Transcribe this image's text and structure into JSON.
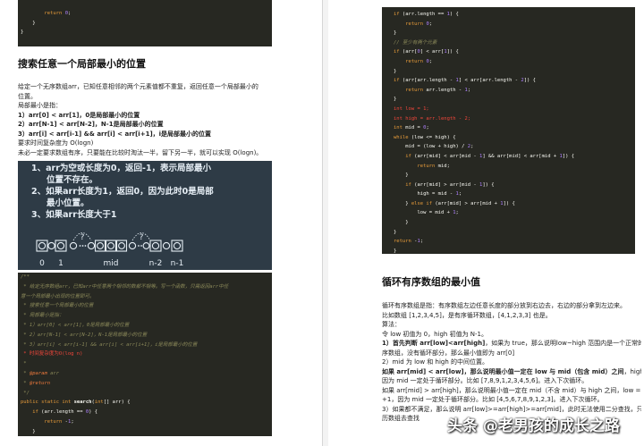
{
  "colors": {
    "page": "#ffffff",
    "text": "#222222",
    "divider": "#d6d6d6",
    "code_bg": "#272822",
    "code_text": "#f8f8f2",
    "keyword": "#e69b3a",
    "number": "#ae81ff",
    "comment": "#8c8a5a",
    "red": "#f2463b",
    "tag": "#f07a3c",
    "figure_bg": "#2e3b46",
    "figure_text": "#e6eef5",
    "watermark": "#ffffff"
  },
  "left_page": {
    "top_code": [
      [
        "        ",
        {
          "kw": "return"
        },
        " ",
        {
          "num": "0"
        },
        ";"
      ],
      "    }",
      "}"
    ],
    "heading": "搜索任意一个局部最小的位置",
    "paragraph_lines": [
      "给定一个无序数组arr，已知任意相邻的两个元素值都不重复，返回任意一个局部最小的",
      "位置。",
      "局部最小是指：",
      [
        {
          "b": "1）arr[0] < arr[1]，0是局部最小的位置"
        }
      ],
      [
        {
          "b": "2）arr[N-1] < arr[N-2]，N-1是局部最小的位置"
        }
      ],
      [
        {
          "b": "3）arr[i] < arr[i-1] && arr[i] < arr[i+1]，i是局部最小的位置"
        }
      ],
      "要求时间复杂度为 O(logn)",
      "未必一定要求数组有序，只要能在比较时淘汰一半，留下另一半，就可以实现 O(logn)。"
    ],
    "figure": {
      "lines": [
        "1、arr为空或长度为0，返回-1，表示局部最小",
        "位置不存在。",
        "2、如果arr长度为1，返回0，因为此时0是局部",
        "最小位置。",
        "3、如果arr长度大于1"
      ],
      "labels": [
        "0",
        "1",
        "mid",
        "n-2",
        "n-1"
      ],
      "question_marks": [
        "?",
        "?"
      ]
    },
    "code": [
      [
        {
          "com": "/**"
        }
      ],
      [
        {
          "com": " * 给定无序数组arr，已知arr中任意两个相邻的数都不相等。写一个函数，只需返回arr中任"
        }
      ],
      [
        {
          "com": "意一个局部最小出现的位置即可。"
        }
      ],
      [
        {
          "com": " * 搜索任意一个局部最小的位置"
        }
      ],
      [
        {
          "com": " * 局部最小是指："
        }
      ],
      [
        {
          "com": " * 1）arr[0] < arr[1]，0是局部最小的位置"
        }
      ],
      [
        {
          "com": " * 2）arr[N-1] < arr[N-2]，N-1是局部最小的位置"
        }
      ],
      [
        {
          "com": " * 3）arr[i] < arr[i-1] && arr[i] < arr[i+1]，i是局部最小的位置"
        }
      ],
      [
        {
          "red": " * 时间复杂度为O(log n)"
        }
      ],
      [
        {
          "com": " *"
        }
      ],
      [
        {
          "com": " * "
        },
        {
          "tag": "@param"
        },
        {
          "com": " arr"
        }
      ],
      [
        {
          "com": " * "
        },
        {
          "tag": "@return"
        }
      ],
      [
        {
          "com": " */"
        }
      ],
      [
        {
          "kw": "public static int"
        },
        " ",
        {
          "fn": "search"
        },
        "(",
        {
          "kw": "int"
        },
        "[] arr) {"
      ],
      [
        "    ",
        {
          "kw": "if"
        },
        " (arr.length == ",
        {
          "num": "0"
        },
        ") {"
      ],
      [
        "        ",
        {
          "kw": "return"
        },
        " -",
        {
          "num": "1"
        },
        ";"
      ],
      "    }"
    ]
  },
  "right_page": {
    "code": [
      [
        {
          "kw": "if"
        },
        " (arr.length == ",
        {
          "num": "1"
        },
        ") {"
      ],
      [
        "    ",
        {
          "kw": "return"
        },
        " ",
        {
          "num": "0"
        },
        ";"
      ],
      "}",
      [
        {
          "com": "// 至少有两个元素"
        }
      ],
      [
        {
          "kw": "if"
        },
        " (arr[",
        {
          "num": "0"
        },
        "] < arr[",
        {
          "num": "1"
        },
        "]) {"
      ],
      [
        "    ",
        {
          "kw": "return"
        },
        " ",
        {
          "num": "0"
        },
        ";"
      ],
      "}",
      [
        {
          "kw": "if"
        },
        " (arr[arr.length - ",
        {
          "num": "1"
        },
        "] < arr[arr.length - ",
        {
          "num": "2"
        },
        "]) {"
      ],
      [
        "    ",
        {
          "kw": "return"
        },
        " arr.length - ",
        {
          "num": "1"
        },
        ";"
      ],
      "}",
      [
        {
          "red": "int low = 1;"
        }
      ],
      [
        {
          "red": "int high = arr.length - 2;"
        }
      ],
      [
        {
          "kw": "int"
        },
        " mid = ",
        {
          "num": "0"
        },
        ";"
      ],
      [
        {
          "kw": "while"
        },
        " (low <= high) {"
      ],
      [
        "    mid = (low + high) / ",
        {
          "num": "2"
        },
        ";"
      ],
      [
        "    ",
        {
          "kw": "if"
        },
        " (arr[mid] < arr[mid - ",
        {
          "num": "1"
        },
        "] && arr[mid] < arr[mid + ",
        {
          "num": "1"
        },
        "]) {"
      ],
      [
        "        ",
        {
          "kw": "return"
        },
        " mid;"
      ],
      "    }",
      [
        "    ",
        {
          "kw": "if"
        },
        " (arr[mid] > arr[mid - ",
        {
          "num": "1"
        },
        "]) {"
      ],
      [
        "        high = mid - ",
        {
          "num": "1"
        },
        ";"
      ],
      [
        "    } ",
        {
          "kw": "else if"
        },
        " (arr[mid] > arr[mid + ",
        {
          "num": "1"
        },
        "]) {"
      ],
      [
        "        low = mid + ",
        {
          "num": "1"
        },
        ";"
      ],
      "    }",
      "}",
      [
        {
          "kw": "return"
        },
        " -",
        {
          "num": "1"
        },
        ";"
      ],
      "}"
    ],
    "heading": "循环有序数组的最小值",
    "paragraph_lines": [
      "循环有序数组是指：有序数组左边任意长度的部分放到右边去，右边的部分拿到左边来。",
      "比如数组 [1,2,3,4,5]，是有序循环数组，[4,1,2,3,3] 也是。",
      "算法：",
      "令 low 初值为 0，high 初值为 N-1。",
      [
        {
          "b": "1）首先判断 arr[low]<arr[high]"
        },
        "，如果为 true，那么说明low~high 范围内是一个正常的有"
      ],
      "序数组，没有循环部分，那么最小值即为 arr[0]",
      "2）mid 为 low 和 high 的中间位置。",
      [
        {
          "b": "如果 arr[mid] < arr[low]，那么说明最小值一定在 low 与 mid（包含 mid）之间"
        },
        "，high = mid，"
      ],
      "因为 mid 一定处于循环部分。比如 [7,8,9,1,2,3,4,5,6]。进入下次循环。",
      "如果 arr[mid] > arr[high]，那么说明最小值一定在 mid（不含 mid）与 high 之间，low = mid",
      "+1，因为 mid 一定处于循环部分。比如 [4,5,6,7,8,9,1,2,3]。进入下次循环。",
      "3）如果都不满足，那么说明 arr[low]>=arr[high]>=arr[mid]，此时无法使用二分查找，只能遍",
      "历数组去查找"
    ]
  },
  "watermark": {
    "text": "头条 @老男孩的成长之路"
  }
}
